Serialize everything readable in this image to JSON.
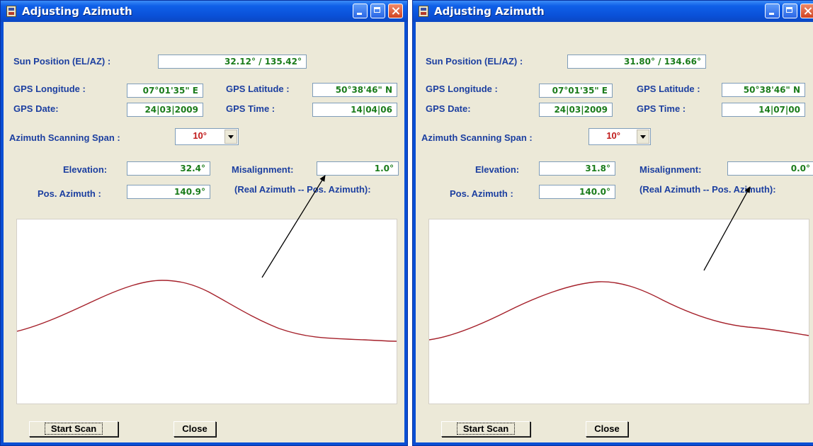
{
  "windows": [
    {
      "title": "Adjusting Azimuth",
      "sun_position_label": "Sun Position (EL/AZ) :",
      "sun_position_el": "32.12°",
      "sun_position_az": " / 135.42°",
      "gps_longitude_label": "GPS Longitude :",
      "gps_longitude": "07°01'35\" E",
      "gps_latitude_label": "GPS Latitude :",
      "gps_latitude": "50°38'46\" N",
      "gps_date_label": "GPS Date:",
      "gps_date": "24|03|2009",
      "gps_time_label": "GPS Time :",
      "gps_time": "14|04|06",
      "azimuth_span_label": "Azimuth Scanning Span :",
      "azimuth_span": "10°",
      "elevation_label": "Elevation:",
      "elevation": "32.4°",
      "misalignment_label": "Misalignment:",
      "misalignment": "1.0°",
      "pos_azimuth_label": "Pos. Azimuth :",
      "pos_azimuth": "140.9°",
      "real_minus_pos_label": "(Real Azimuth -- Pos. Azimuth):",
      "start_scan_label": "Start Scan",
      "close_label": "Close"
    },
    {
      "title": "Adjusting Azimuth",
      "sun_position_label": "Sun Position (EL/AZ) :",
      "sun_position_el": "31.80°",
      "sun_position_az": " / 134.66°",
      "gps_longitude_label": "GPS Longitude :",
      "gps_longitude": "07°01'35\" E",
      "gps_latitude_label": "GPS Latitude :",
      "gps_latitude": "50°38'46\" N",
      "gps_date_label": "GPS Date:",
      "gps_date": "24|03|2009",
      "gps_time_label": "GPS Time :",
      "gps_time": "14|07|00",
      "azimuth_span_label": "Azimuth Scanning Span :",
      "azimuth_span": "10°",
      "elevation_label": "Elevation:",
      "elevation": "31.8°",
      "misalignment_label": "Misalignment:",
      "misalignment": "0.0°",
      "pos_azimuth_label": "Pos. Azimuth :",
      "pos_azimuth": "140.0°",
      "real_minus_pos_label": "(Real Azimuth -- Pos. Azimuth):",
      "start_scan_label": "Start Scan",
      "close_label": "Close"
    }
  ],
  "colors": {
    "title_bar": "#0a51d8",
    "window_face": "#ece9d8",
    "label_text": "#1c3fa0",
    "field_value": "#1b7c1b",
    "span_value": "#c01a1a",
    "curve": "#a5202a"
  }
}
